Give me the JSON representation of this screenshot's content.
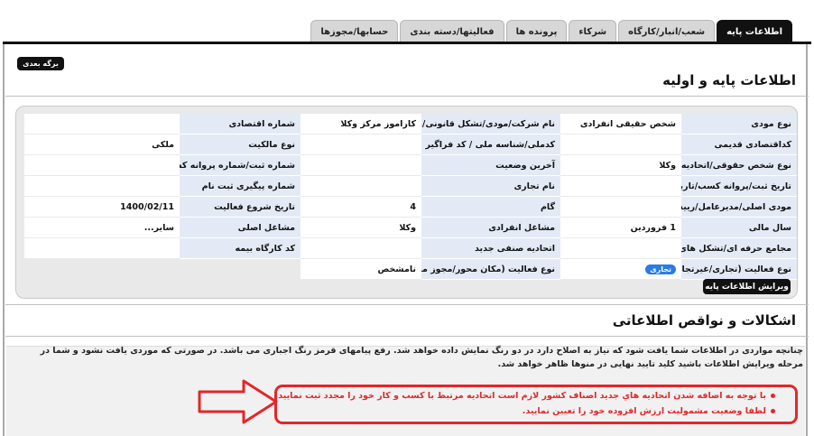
{
  "tabs": [
    {
      "label": "اطلاعات پایه",
      "active": true
    },
    {
      "label": "شعب/انبار/کارگاه",
      "active": false
    },
    {
      "label": "شرکاء",
      "active": false
    },
    {
      "label": "پرونده ها",
      "active": false
    },
    {
      "label": "فعالیتها/دسته بندی",
      "active": false
    },
    {
      "label": "حسابها/مجوزها",
      "active": false
    }
  ],
  "next_tab_label": "برگه بعدی",
  "section1_title": "اطلاعات پایه و اولیه",
  "fields": [
    [
      {
        "l": "نوع مودی",
        "v": "شخص حقیقی انفرادی"
      },
      {
        "l": "نام شرکت/مودی/تشکل قانونی/واحد صنفی",
        "v": "کاراموز مرکز وکلا"
      },
      {
        "l": "شماره اقتصادی",
        "v": ""
      }
    ],
    [
      {
        "l": "کداقتصادی قدیمی",
        "v": ""
      },
      {
        "l": "کدملی/شناسه ملی / کد فراگیر",
        "v": ""
      },
      {
        "l": "نوع مالکیت",
        "v": "ملکی"
      }
    ],
    [
      {
        "l": "نوع شخص حقوقی/اتحادیه صنفی",
        "v": "وکلا"
      },
      {
        "l": "آخرین وضعیت",
        "v": ""
      },
      {
        "l": "شماره ثبت/شماره پروانه کسب",
        "v": ""
      }
    ],
    [
      {
        "l": "تاریخ ثبت/پروانه کسب/تاریخ تاسیس",
        "v": ""
      },
      {
        "l": "نام تجاری",
        "v": ""
      },
      {
        "l": "شماره پیگیری ثبت نام",
        "v": ""
      }
    ],
    [
      {
        "l": "مودی اصلی/مدیرعامل/رییس دستگاه",
        "v": ""
      },
      {
        "l": "گام",
        "v": "4"
      },
      {
        "l": "تاریخ شروع فعالیت",
        "v": "1400/02/11"
      }
    ],
    [
      {
        "l": "سال مالی",
        "v": "1 فروردین"
      },
      {
        "l": "مشاغل انفرادی",
        "v": "وکلا"
      },
      {
        "l": "مشاغل اصلی",
        "v": "سایر..."
      }
    ],
    [
      {
        "l": "مجامع حرفه ای/تشکل های صنفی",
        "v": ""
      },
      {
        "l": "اتحادیه صنفی جدید",
        "v": ""
      },
      {
        "l": "کد کارگاه بیمه",
        "v": ""
      }
    ],
    [
      {
        "l": "نوع فعالیت (تجاری/غیرتجاری)",
        "v": "تجاری",
        "badge": true
      },
      {
        "l": "نوع فعالیت (مکان محور/مجوز محور)",
        "v": "نامشخص"
      },
      {
        "l": "",
        "v": ""
      }
    ]
  ],
  "edit_button_label": "ویرایش اطلاعات پایه",
  "section2_title": "اشکالات و نواقص اطلاعاتی",
  "notes_paragraph": "چنانچه مواردی در اطلاعات شما یافت شود که نیاز به اصلاح دارد در دو رنگ نمایش داده خواهد شد. رفع پیامهای قرمز رنگ اجباری می باشد. در صورتی که موردی یافت نشود و شما در مرحله ویرایش اطلاعات باشید کلید تایید نهایی در منوها ظاهر خواهد شد.",
  "warnings": [
    "با توجه به اضافه شدن اتحادیه هاي جدید اصناف کشور لازم است اتحادیه مرتبط با کسب و کار خود را مجدد ثبت نمایید.",
    "لطفا وضعیت مشمولیت ارزش افزوده خود را تعیین نمایید."
  ],
  "colors": {
    "accent": "#111111",
    "label_bg": "#e4eaf5",
    "warning": "#e3262b",
    "badge": "#2a7be4"
  }
}
